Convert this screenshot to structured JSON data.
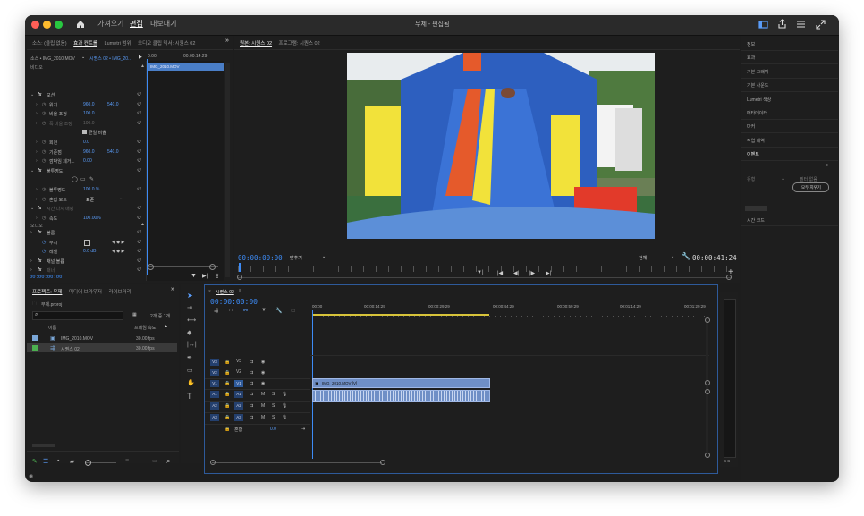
{
  "titlebar": {
    "home_icon": "home-icon",
    "tabs": [
      "가져오기",
      "편집",
      "내보내기"
    ],
    "title": "무제 - 편집됨"
  },
  "effect_controls": {
    "tabs": [
      "소스: (클립 없음)",
      "효과 컨트롤",
      "Lumetri 범위",
      "오디오 클립 믹서: 시퀀스 02"
    ],
    "source": "소스 • IMG_2010.MOV",
    "sequence": "시퀀스 02 • IMG_20...",
    "times": [
      "0:00",
      "00:00:14:29"
    ],
    "clip_name": "IMG_2010.MOV",
    "sections": {
      "video": "비디오",
      "audio": "오디오"
    },
    "rows": [
      {
        "label": "모션",
        "indent": 0,
        "fx": true
      },
      {
        "label": "위치",
        "indent": 2,
        "v1": "960.0",
        "v2": "540.0"
      },
      {
        "label": "비율 조정",
        "indent": 2,
        "v1": "100.0"
      },
      {
        "label": "폭 비율 조정",
        "indent": 2,
        "v1": "100.0",
        "dim": true
      },
      {
        "label": "균일 비율",
        "indent": 5,
        "check": true
      },
      {
        "label": "회전",
        "indent": 2,
        "v1": "0.0"
      },
      {
        "label": "기준점",
        "indent": 2,
        "v1": "960.0",
        "v2": "540.0"
      },
      {
        "label": "깜박임 제거...",
        "indent": 2,
        "v1": "0.00"
      },
      {
        "label": "불투명도",
        "indent": 0,
        "fx": true
      },
      {
        "label": "",
        "indent": 4,
        "shapes": true
      },
      {
        "label": "불투명도",
        "indent": 2,
        "v1": "100.0 %"
      },
      {
        "label": "혼합 모드",
        "indent": 4,
        "v1": "표준",
        "dropdown": true
      },
      {
        "label": "시간 다시 매핑",
        "indent": 0,
        "fx": true,
        "dim": true
      },
      {
        "label": "속도",
        "indent": 2,
        "v1": "100.00%"
      }
    ],
    "audio_rows": [
      {
        "label": "볼륨",
        "indent": 0,
        "fx": true
      },
      {
        "label": "무시",
        "indent": 2
      },
      {
        "label": "레벨",
        "indent": 2,
        "v1": "0.0 dB"
      },
      {
        "label": "채널 볼륨",
        "indent": 0,
        "fx": true
      },
      {
        "label": "패너",
        "indent": 0,
        "fx": true,
        "dim": true
      }
    ],
    "bottom_tc": "00:00:00:00"
  },
  "program": {
    "tabs": [
      "원본: 시퀀스 02",
      "프로그램: 시퀀스 02"
    ],
    "timecode": "00:00:00:00",
    "fit": "맞추기",
    "quality": "전체",
    "duration": "00:00:41:24"
  },
  "project": {
    "tabs": [
      "프로젝트: 무제",
      "미디어 브라우저",
      "라이브러리"
    ],
    "file": "무제.prproj",
    "count": "2개 중 1개...",
    "search_placeholder": "",
    "col_name": "이름",
    "col_fps": "프레임 속도",
    "items": [
      {
        "name": "IMG_2010.MOV",
        "fps": "30.00 fps",
        "color": "#7aa7d8"
      },
      {
        "name": "시퀀스 02",
        "fps": "30.00 fps",
        "color": "#4caf50"
      }
    ]
  },
  "timeline": {
    "tab": "시퀀스 02",
    "timecode": "00:00:00:00",
    "ruler": [
      "00:00",
      "00:00:14:29",
      "00:00:29:29",
      "00:00:44:29",
      "00:00:59:29",
      "00:01:14:29",
      "00:01:29:29"
    ],
    "video_tracks": [
      "V3",
      "V2",
      "V1"
    ],
    "audio_tracks": [
      "A1",
      "A2",
      "A3"
    ],
    "mix_label": "혼합",
    "mix_value": "0.0",
    "video_clip": "IMG_2010.MOV [V]"
  },
  "right_panel": {
    "items": [
      "정보",
      "효과",
      "기본 그래픽",
      "기본 사운드",
      "Lumetri 색상",
      "메타데이터",
      "마커",
      "작업 내역",
      "이벤트"
    ],
    "filter_label": "필터 없음",
    "clear_btn": "모두 지우기",
    "timecode_label": "시간 코드"
  },
  "meter": {
    "label": "S S"
  }
}
